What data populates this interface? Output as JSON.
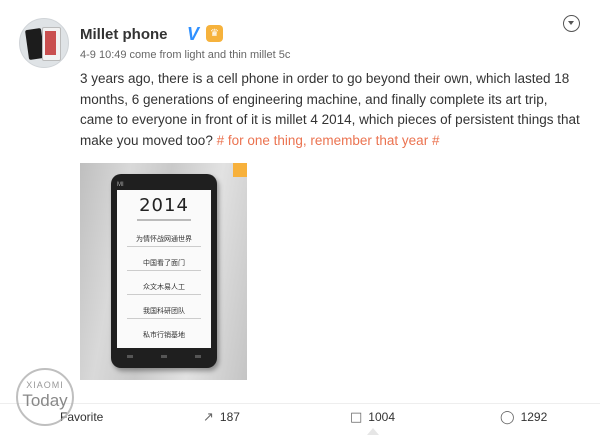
{
  "post": {
    "author": "Millet phone",
    "verified_mark": "V",
    "meta": "4-9 10:49 come from light and thin millet 5c",
    "text_before": "3 years ago, there is a cell phone in order to go beyond their own, which lasted 18 months, 6 generations of engineering machine, and finally complete its art trip, came to everyone in front of it is millet 4 2014, which pieces of persistent things that make you moved too? ",
    "topic": "# for one thing, remember that year #"
  },
  "image": {
    "year": "2014",
    "brand_mark": "MI",
    "rows": [
      "为情怀战网通世界",
      "中国看了面门",
      "众文木易人工",
      "我国科研团队",
      "私市行销基地"
    ]
  },
  "actions": {
    "favorite_label": "Favorite",
    "forward_count": "187",
    "comment_count": "1004",
    "like_count": "1292"
  },
  "watermark": {
    "line1": "XIAOMI",
    "line2": "Today"
  },
  "icons": {
    "menu": "chevron-circle-icon",
    "forward": "forward-icon",
    "comment": "comment-icon",
    "like": "like-icon"
  }
}
